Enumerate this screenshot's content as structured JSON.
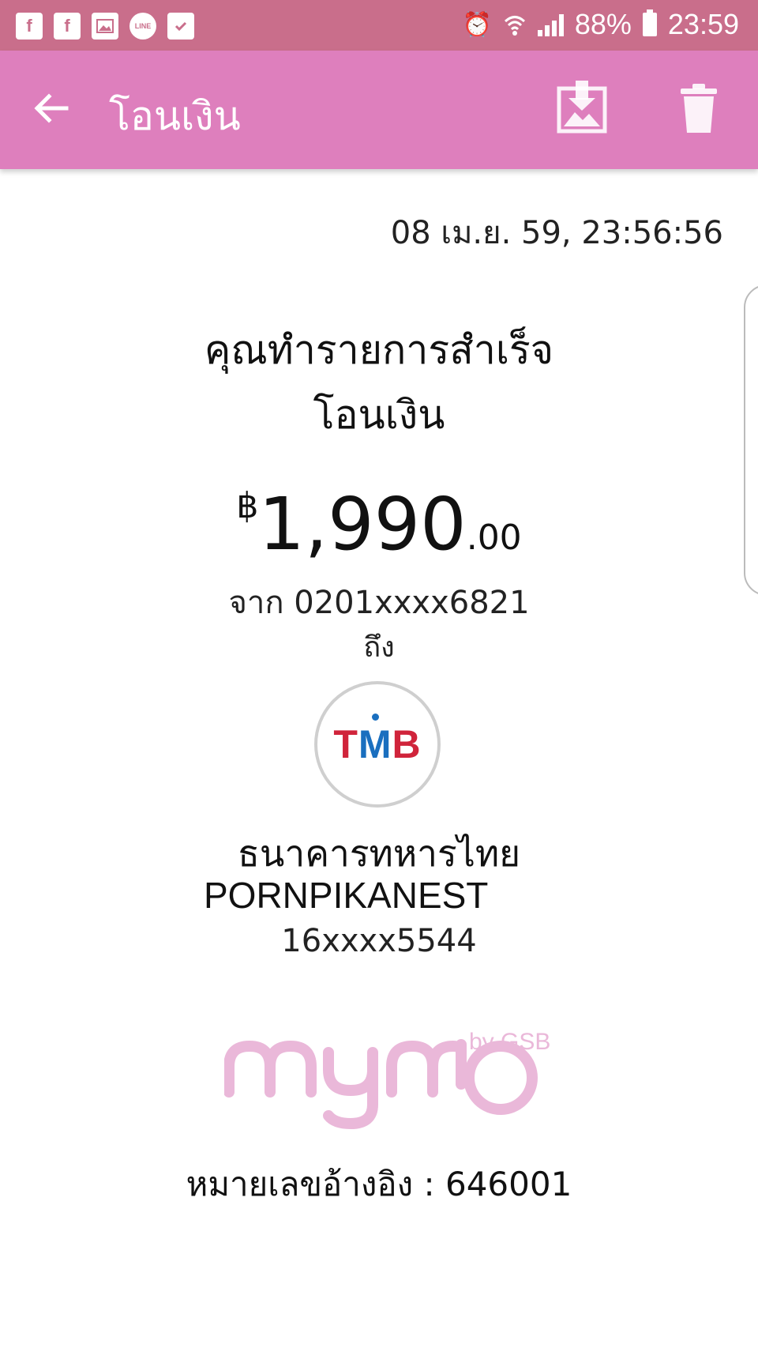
{
  "status_bar": {
    "notifications": [
      "facebook-icon",
      "facebook-icon",
      "gallery-icon",
      "line-icon",
      "briefcase-icon"
    ],
    "battery": "88%",
    "time": "23:59"
  },
  "app_bar": {
    "title": "โอนเงิน"
  },
  "receipt": {
    "timestamp": "08 เม.ย. 59, 23:56:56",
    "headline_1": "คุณทำรายการสำเร็จ",
    "headline_2": "โอนเงิน",
    "currency": "฿",
    "amount_int": "1,990",
    "amount_dec": ".00",
    "from_label": "จาก",
    "from_account": "0201xxxx6821",
    "to_label": "ถึง",
    "bank_logo_text": {
      "left": "T",
      "mid": "M",
      "right": "B"
    },
    "bank_name": "ธนาคารทหารไทย",
    "recipient_name": "PORNPIKANEST",
    "recipient_account": "16xxxx5544",
    "brand": {
      "by": "by GSB"
    },
    "reference_label": "หมายเลขอ้างอิง",
    "reference_sep": ":",
    "reference_number": "646001"
  },
  "colors": {
    "status_bar": "#c96e8b",
    "app_bar": "#de7fbd",
    "brand_logo": "#eab8d9",
    "bank_red": "#d0243b",
    "bank_blue": "#1a6fbf"
  }
}
